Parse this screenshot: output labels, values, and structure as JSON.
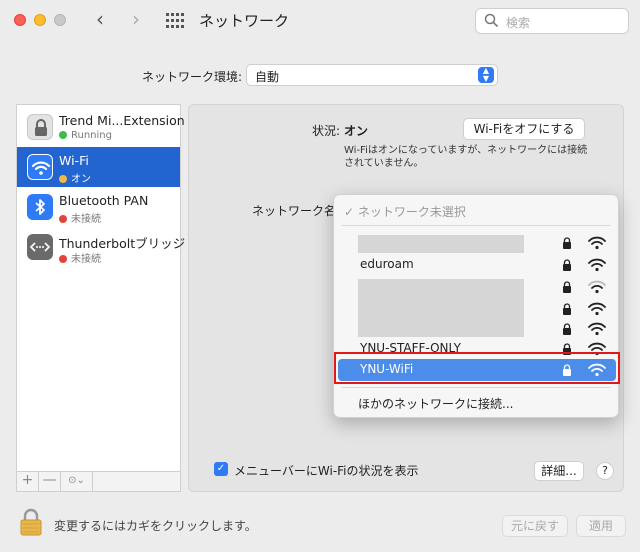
{
  "window": {
    "title": "ネットワーク",
    "search_placeholder": "検索"
  },
  "location": {
    "label": "ネットワーク環境:",
    "value": "自動"
  },
  "services": [
    {
      "name": "Trend Mi...Extension",
      "status": "Running",
      "status_color": "#3dbb4a",
      "icon": "lock-icon"
    },
    {
      "name": "Wi-Fi",
      "status": "オン",
      "status_color": "#f4b942",
      "icon": "wifi-icon"
    },
    {
      "name": "Bluetooth PAN",
      "status": "未接続",
      "status_color": "#e5433a",
      "icon": "bluetooth-icon"
    },
    {
      "name": "Thunderboltブリッジ",
      "status": "未接続",
      "status_color": "#e5433a",
      "icon": "thunderbolt-bridge-icon"
    }
  ],
  "sidebar_buttons": {
    "add": "+",
    "remove": "—",
    "action": "⊙⌄"
  },
  "status": {
    "label": "状況:",
    "value": "オン",
    "toggle_button": "Wi-Fiをオフにする",
    "description": "Wi-Fiはオンになっていますが、ネットワークには接続されていません。"
  },
  "network_name_label": "ネットワーク名",
  "network_menu": {
    "none_selected": "✓ ネットワーク未選択",
    "networks": [
      {
        "name": "",
        "redacted": true
      },
      {
        "name": "eduroam",
        "redacted": false
      },
      {
        "name": "",
        "redacted": true
      },
      {
        "name": "",
        "redacted": true
      },
      {
        "name": "",
        "redacted": true
      },
      {
        "name": "YNU-STAFF-ONLY",
        "redacted": false
      }
    ],
    "highlighted": "YNU-WiFi",
    "other": "ほかのネットワークに接続..."
  },
  "show_in_menubar": {
    "label": "メニューバーにWi-Fiの状況を表示",
    "checked": true
  },
  "buttons": {
    "advanced": "詳細...",
    "help": "?",
    "revert": "元に戻す",
    "apply": "適用"
  },
  "lock_text": "変更するにはカギをクリックします。",
  "colors": {
    "accent": "#2f7bf5",
    "selection": "#2365d0",
    "highlight": "#4b8de8",
    "annotation_border": "#e01818"
  }
}
